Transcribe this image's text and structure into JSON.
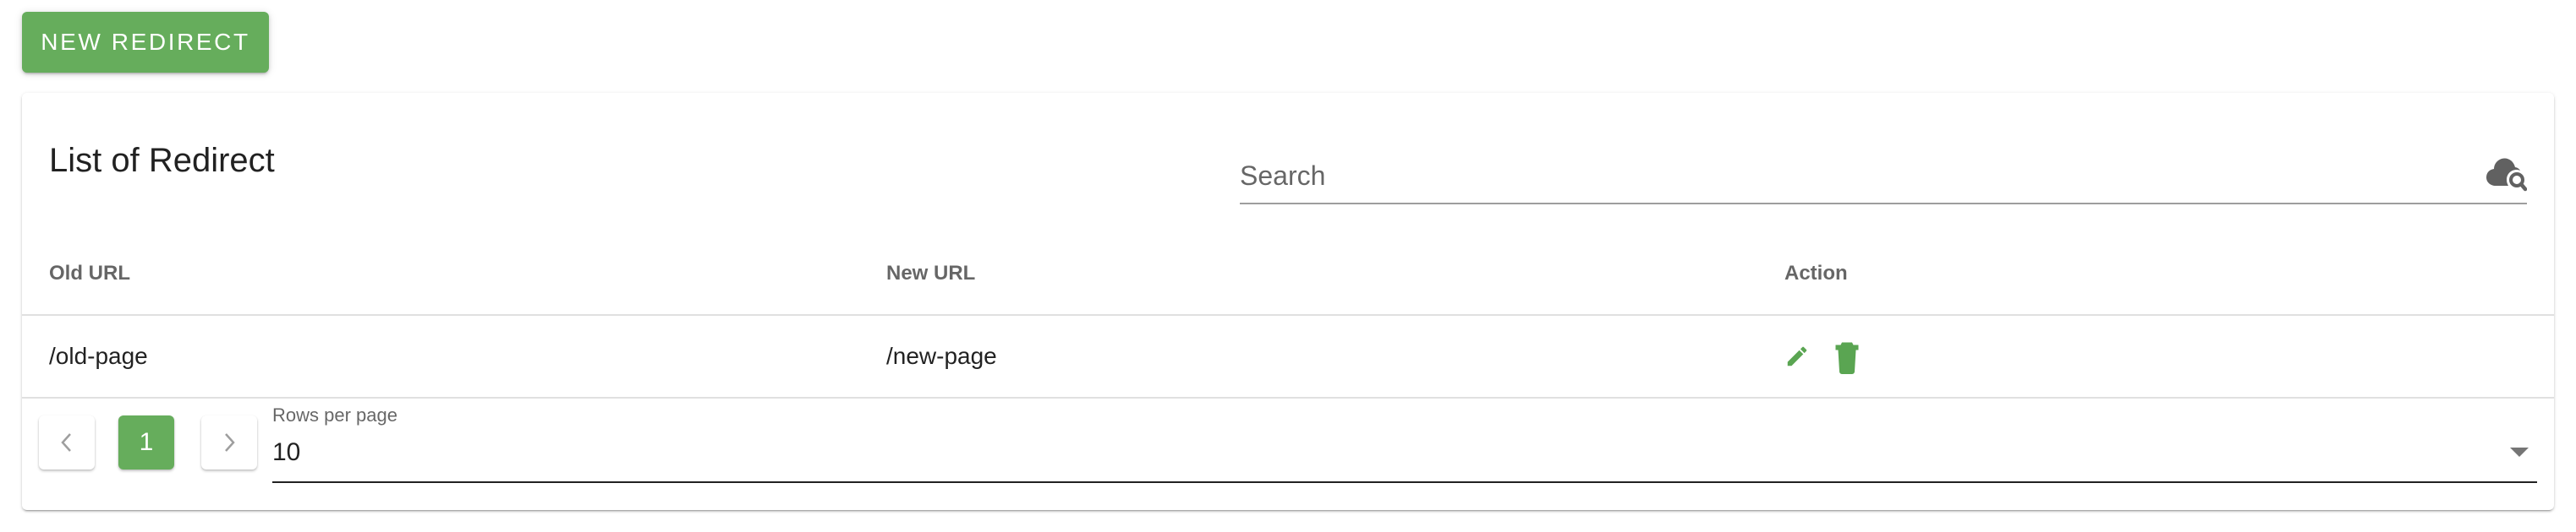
{
  "toolbar": {
    "new_redirect_label": "New Redirect"
  },
  "card": {
    "title": "List of Redirect",
    "search": {
      "placeholder": "Search",
      "value": "",
      "icon": "cloud-search-icon"
    }
  },
  "table": {
    "headers": {
      "old_url": "Old URL",
      "new_url": "New URL",
      "action": "Action"
    },
    "rows": [
      {
        "old_url": "/old-page",
        "new_url": "/new-page",
        "actions": [
          "edit-icon",
          "delete-icon"
        ]
      }
    ]
  },
  "pagination": {
    "prev_icon": "chevron-left-icon",
    "current_page": "1",
    "next_icon": "chevron-right-icon",
    "rows_per_page_label": "Rows per page",
    "rows_per_page_value": "10"
  },
  "colors": {
    "accent": "#66ad5c",
    "icon_green": "#5aa552",
    "icon_gray": "#616161"
  }
}
